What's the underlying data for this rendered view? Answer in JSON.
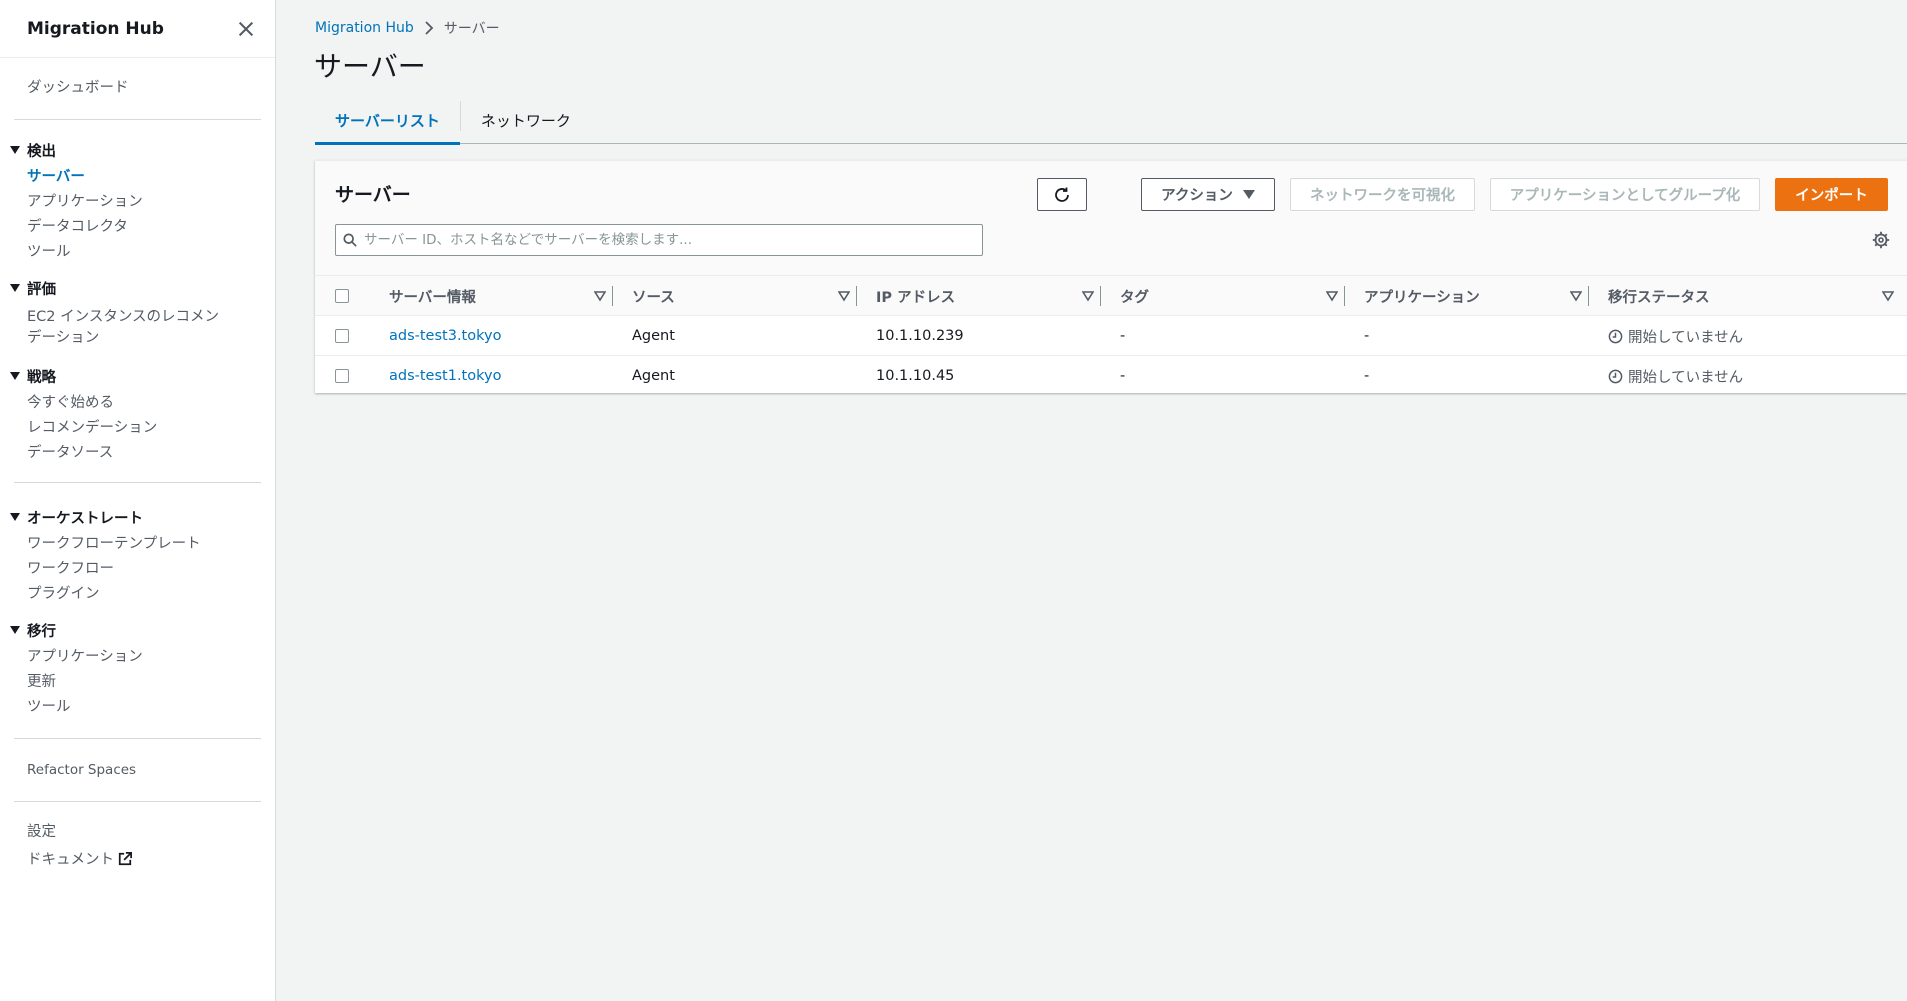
{
  "sidebar": {
    "title": "Migration Hub",
    "dashboard": "ダッシュボード",
    "sections": {
      "discover": {
        "label": "検出",
        "items": [
          "サーバー",
          "アプリケーション",
          "データコレクタ",
          "ツール"
        ]
      },
      "assess": {
        "label": "評価",
        "items": [
          "EC2 インスタンスのレコメンデーション"
        ]
      },
      "strategy": {
        "label": "戦略",
        "items": [
          "今すぐ始める",
          "レコメンデーション",
          "データソース"
        ]
      },
      "orchestrate": {
        "label": "オーケストレート",
        "items": [
          "ワークフローテンプレート",
          "ワークフロー",
          "プラグイン"
        ]
      },
      "migrate": {
        "label": "移行",
        "items": [
          "アプリケーション",
          "更新",
          "ツール"
        ]
      }
    },
    "refactor": "Refactor Spaces",
    "settings": "設定",
    "docs": "ドキュメント"
  },
  "breadcrumb": {
    "root": "Migration Hub",
    "current": "サーバー"
  },
  "page_title": "サーバー",
  "tabs": [
    "サーバーリスト",
    "ネットワーク"
  ],
  "container": {
    "title": "サーバー",
    "buttons": {
      "actions": "アクション",
      "visualize": "ネットワークを可視化",
      "group": "アプリケーションとしてグループ化",
      "import": "インポート"
    },
    "search_placeholder": "サーバー ID、ホスト名などでサーバーを検索します..."
  },
  "table": {
    "columns": [
      "サーバー情報",
      "ソース",
      "IP アドレス",
      "タグ",
      "アプリケーション",
      "移行ステータス"
    ],
    "rows": [
      {
        "server": "ads-test3.tokyo",
        "source": "Agent",
        "ip": "10.1.10.239",
        "tags": "-",
        "app": "-",
        "status": "開始していません"
      },
      {
        "server": "ads-test1.tokyo",
        "source": "Agent",
        "ip": "10.1.10.45",
        "tags": "-",
        "app": "-",
        "status": "開始していません"
      }
    ]
  },
  "colors": {
    "accent": "#0073bb",
    "primary_button": "#ec7211",
    "page_bg": "#f2f3f3"
  },
  "icons": [
    "close-icon",
    "chevron-right-icon",
    "refresh-icon",
    "caret-down-icon",
    "search-icon",
    "gear-icon",
    "sort-icon",
    "clock-icon",
    "external-link-icon"
  ]
}
